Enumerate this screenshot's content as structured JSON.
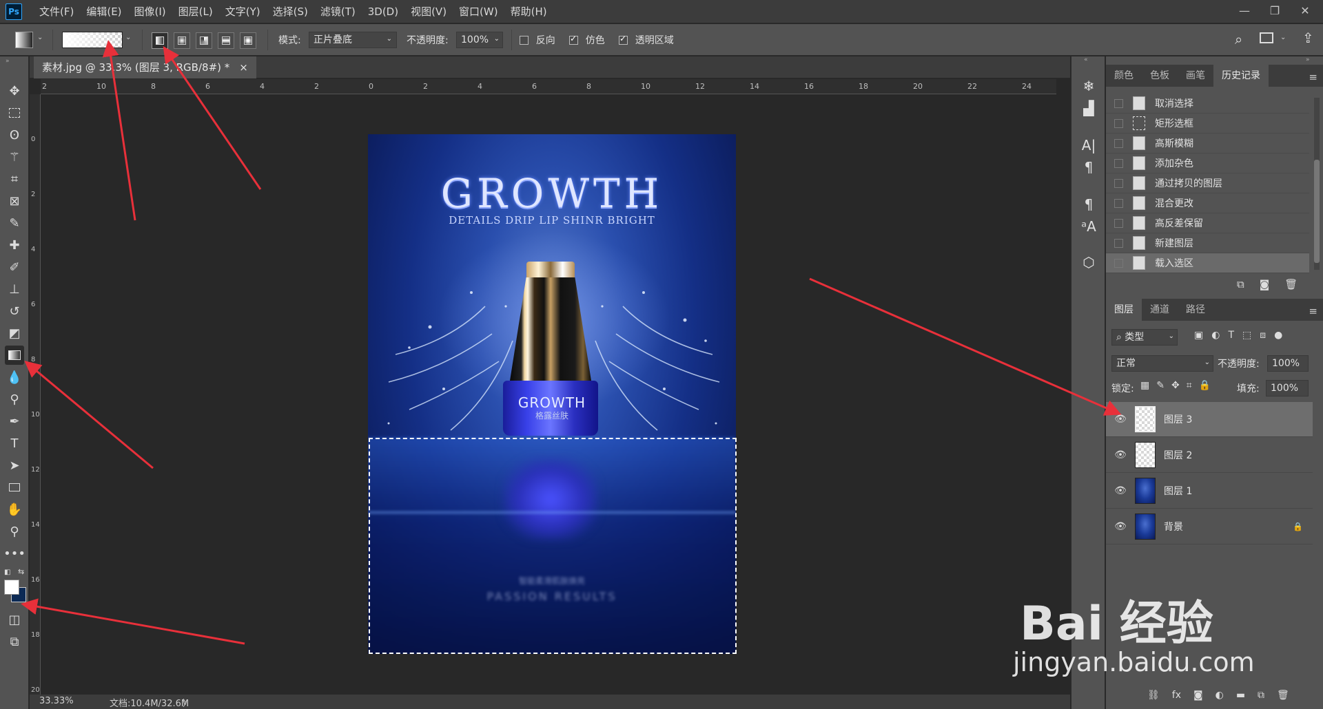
{
  "app": {
    "logo": "Ps"
  },
  "menu": [
    "文件(F)",
    "编辑(E)",
    "图像(I)",
    "图层(L)",
    "文字(Y)",
    "选择(S)",
    "滤镜(T)",
    "3D(D)",
    "视图(V)",
    "窗口(W)",
    "帮助(H)"
  ],
  "options": {
    "mode_label": "模式:",
    "mode_value": "正片叠底",
    "opacity_label": "不透明度:",
    "opacity_value": "100%",
    "reverse_label": "反向",
    "dither_label": "仿色",
    "transparency_label": "透明区域",
    "reverse_checked": false,
    "dither_checked": true,
    "transparency_checked": true
  },
  "document": {
    "tab_title": "素材.jpg @ 33.3% (图层 3, RGB/8#) *",
    "close_glyph": "×"
  },
  "ruler": {
    "h_labels": [
      "2",
      "10",
      "8",
      "6",
      "4",
      "2",
      "0",
      "2",
      "4",
      "6",
      "8",
      "10",
      "12",
      "14",
      "16",
      "18",
      "20",
      "22",
      "24"
    ],
    "v_labels": [
      "0",
      "2",
      "4",
      "6",
      "8",
      "10",
      "12",
      "14",
      "16",
      "18",
      "20"
    ]
  },
  "poster": {
    "title": "GROWTH",
    "subtitle": "DETAILS DRIP LIP SHINR BRIGHT",
    "bottle_label": "GROWTH",
    "bottle_sub": "格露丝肤",
    "reflect_line1": "智能柔滑肌肤焕亮",
    "reflect_line2": "PASSION RESULTS"
  },
  "status": {
    "zoom": "33.33%",
    "doc_info": "文档:10.4M/32.6M",
    "arrow": "〉"
  },
  "panels": {
    "top_tabs": [
      "颜色",
      "色板",
      "画笔",
      "历史记录"
    ],
    "history": [
      "取消选择",
      "矩形选框",
      "高斯模糊",
      "添加杂色",
      "通过拷贝的图层",
      "混合更改",
      "高反差保留",
      "新建图层",
      "载入选区"
    ],
    "layer_tabs": [
      "图层",
      "通道",
      "路径"
    ],
    "filter_label": "类型",
    "blend_mode": "正常",
    "opacity_label": "不透明度:",
    "opacity_value": "100%",
    "lock_label": "锁定:",
    "fill_label": "填充:",
    "fill_value": "100%",
    "layers": [
      {
        "name": "图层 3",
        "thumb": "transparent",
        "active": true
      },
      {
        "name": "图层 2",
        "thumb": "transparent",
        "active": false
      },
      {
        "name": "图层 1",
        "thumb": "image",
        "active": false
      },
      {
        "name": "背景",
        "thumb": "image",
        "active": false,
        "locked": true
      }
    ]
  },
  "watermark": {
    "main": "Bai 经验",
    "url": "jingyan.baidu.com"
  },
  "colors": {
    "panel_bg": "#535353",
    "canvas_bg": "#282828",
    "annotation_arrow": "#e8303a",
    "poster_blue": "#142f86"
  }
}
